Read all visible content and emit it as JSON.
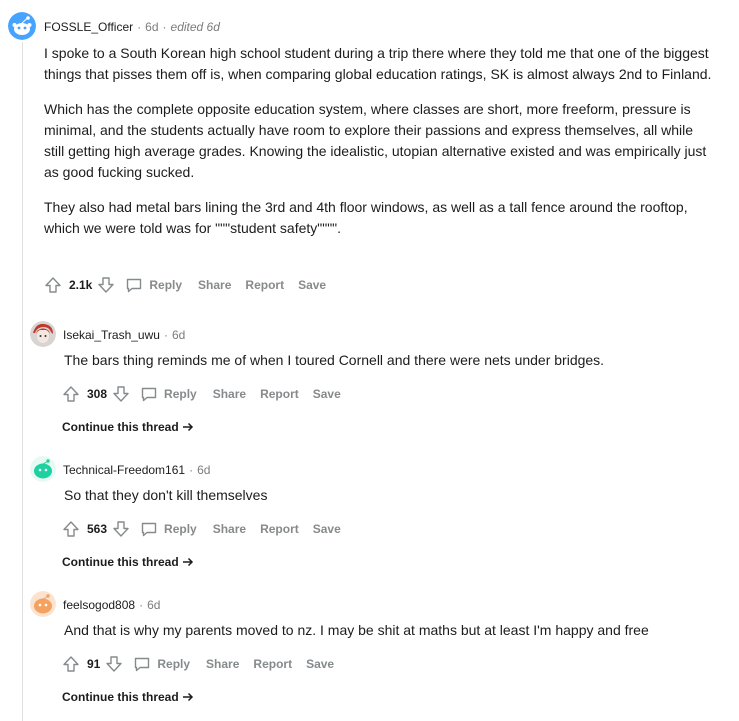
{
  "comments": [
    {
      "username": "FOSSLE_Officer",
      "age": "6d",
      "edited": "edited 6d",
      "paragraphs": [
        "I spoke to a South Korean high school student during a trip there where they told me that one of the biggest things that pisses them off is, when comparing global education ratings, SK is almost always 2nd to Finland.",
        "Which has the complete opposite education system, where classes are short, more freeform, pressure is minimal, and the students actually have room to explore their passions and express themselves, all while still getting high average grades. Knowing the idealistic, utopian alternative existed and was empirically just as good fucking sucked.",
        "They also had metal bars lining the 3rd and 4th floor windows, as well as a tall fence around the rooftop, which we were told was for \"\"\"student safety\"\"\"\"."
      ],
      "score": "2.1k"
    },
    {
      "username": "Isekai_Trash_uwu",
      "age": "6d",
      "text": "The bars thing reminds me of when I toured Cornell and there were nets under bridges.",
      "score": "308"
    },
    {
      "username": "Technical-Freedom161",
      "age": "6d",
      "text": "So that they don't kill themselves",
      "score": "563"
    },
    {
      "username": "feelsogod808",
      "age": "6d",
      "text": "And that is why my parents moved to nz. I may be shit at maths but at least I'm happy and free",
      "score": "91"
    }
  ],
  "labels": {
    "reply": "Reply",
    "share": "Share",
    "report": "Report",
    "save": "Save",
    "continue_thread": "Continue this thread",
    "separator": "·"
  },
  "icons": {
    "upvote": "upvote-arrow-icon",
    "downvote": "downvote-arrow-icon",
    "reply": "chat-bubble-icon",
    "continue": "arrow-right-icon"
  },
  "colors": {
    "text": "#1c1c1c",
    "meta": "#7c7c7c",
    "action": "#878a8c",
    "avatar_main": "#46a3ff",
    "avatar_teal": "#1dd1a1",
    "avatar_orange": "#f4a261",
    "avatar_red": "#c0392b"
  }
}
